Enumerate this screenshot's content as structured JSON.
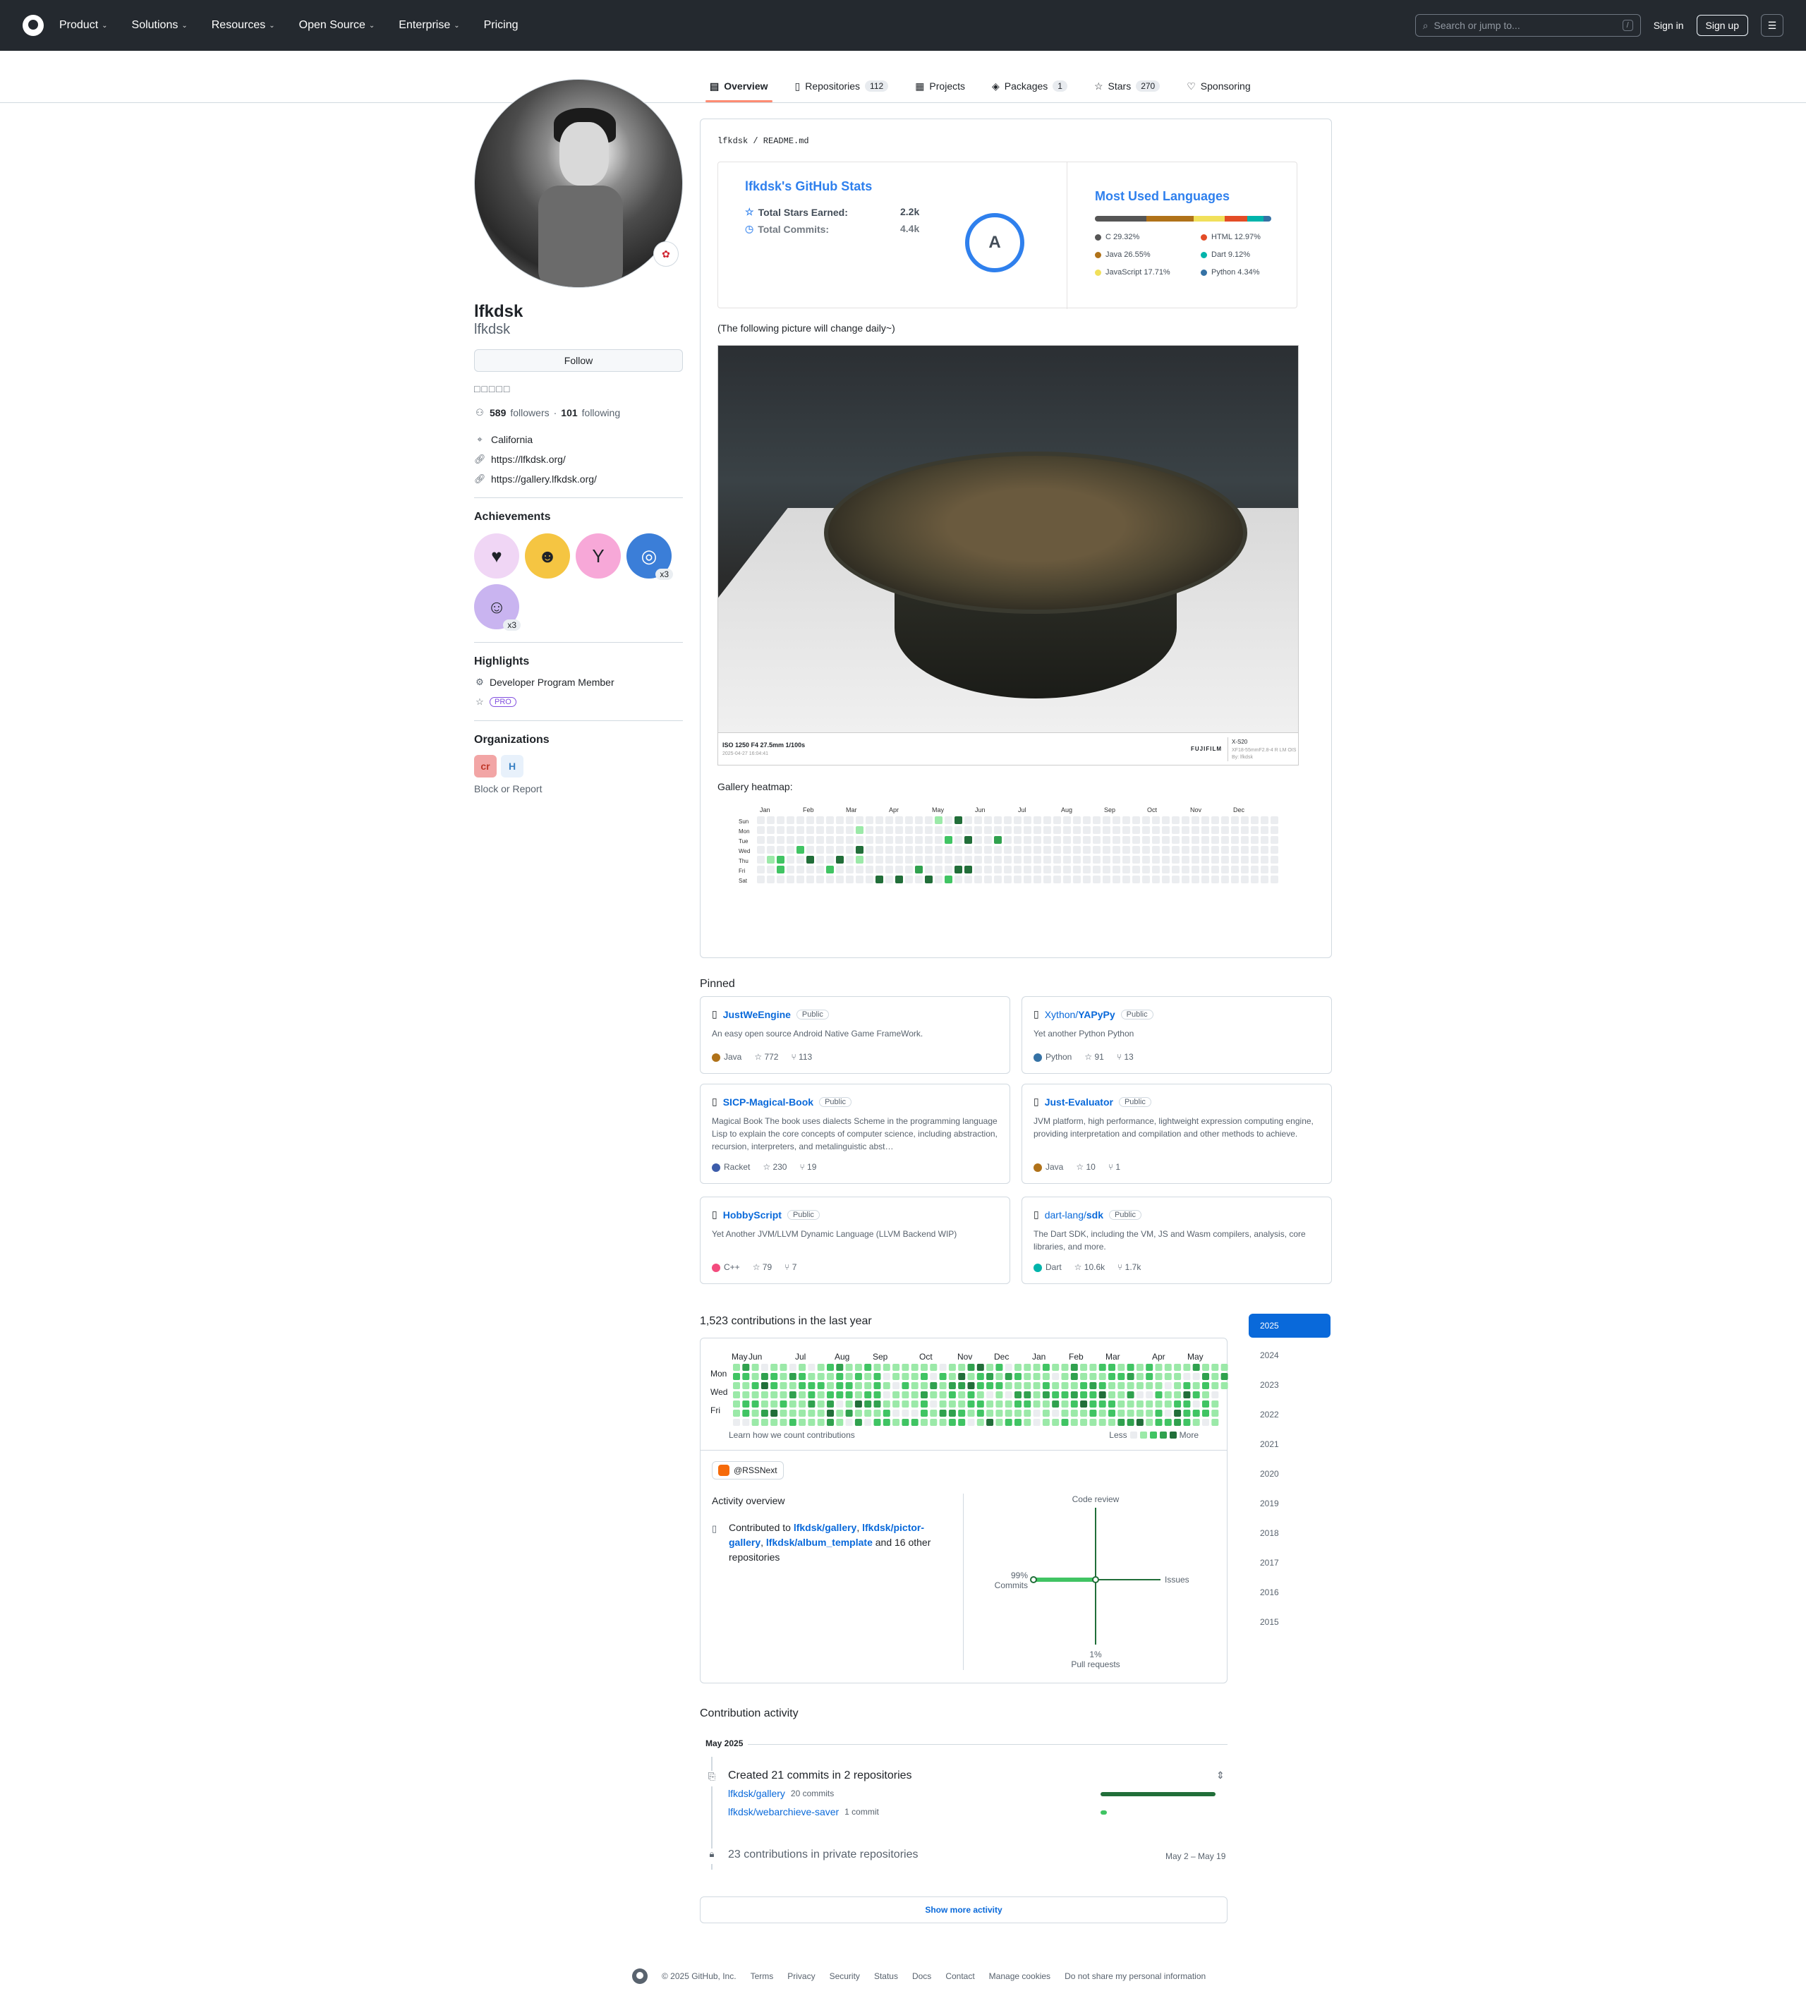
{
  "header": {
    "nav": [
      "Product",
      "Solutions",
      "Resources",
      "Open Source",
      "Enterprise",
      "Pricing"
    ],
    "search_placeholder": "Search or jump to...",
    "slash": "/",
    "signin": "Sign in",
    "signup": "Sign up"
  },
  "tabs": [
    {
      "label": "Overview"
    },
    {
      "label": "Repositories",
      "count": "112"
    },
    {
      "label": "Projects"
    },
    {
      "label": "Packages",
      "count": "1"
    },
    {
      "label": "Stars",
      "count": "270"
    },
    {
      "label": "Sponsoring"
    }
  ],
  "profile": {
    "name": "lfkdsk",
    "login": "lfkdsk",
    "follow": "Follow",
    "bio": "□□□□□",
    "followers": "589",
    "followers_label": "followers",
    "following": "101",
    "following_label": "following",
    "location": "California",
    "links": [
      "https://lfkdsk.org/",
      "https://gallery.lfkdsk.org/"
    ]
  },
  "achievements": {
    "title": "Achievements",
    "badges": [
      {
        "x": ""
      },
      {
        "x": ""
      },
      {
        "x": ""
      },
      {
        "x": "x3"
      },
      {
        "x": "x3"
      }
    ]
  },
  "highlights": {
    "title": "Highlights",
    "member": "Developer Program Member",
    "pro": "PRO"
  },
  "organizations": {
    "title": "Organizations",
    "block": "Block or Report"
  },
  "readme": {
    "path": "lfkdsk / README.md",
    "stats_title": "lfkdsk's GitHub Stats",
    "stars_label": "Total Stars Earned:",
    "stars_val": "2.2k",
    "commits_label": "Total Commits:",
    "commits_val": "4.4k",
    "grade": "A",
    "lang_title": "Most Used Languages",
    "langs": [
      {
        "name": "C 29.32%",
        "color": "#555555",
        "pct": 29.32
      },
      {
        "name": "Java 26.55%",
        "color": "#b07219",
        "pct": 26.55
      },
      {
        "name": "JavaScript 17.71%",
        "color": "#f1e05a",
        "pct": 17.71
      },
      {
        "name": "HTML 12.97%",
        "color": "#e34c26",
        "pct": 12.97
      },
      {
        "name": "Dart 9.12%",
        "color": "#00b4ab",
        "pct": 9.12
      },
      {
        "name": "Python 4.34%",
        "color": "#3572A5",
        "pct": 4.34
      }
    ],
    "note": "(The following picture will change daily~)",
    "photo_caption": "ISO 1250 F4 27.5mm 1/100s",
    "photo_date": "2025-04-27 16:04:41",
    "photo_brand": "FUJIFILM",
    "photo_model": "X-S20",
    "photo_lens": "XF18-55mmF2.8-4 R LM OIS",
    "photo_by": "By: lfkdsk",
    "gallery_heatmap": "Gallery heatmap:",
    "hm_months": [
      "Jan",
      "Feb",
      "Mar",
      "Apr",
      "May",
      "Jun",
      "Jul",
      "Aug",
      "Sep",
      "Oct",
      "Nov",
      "Dec"
    ],
    "hm_days": [
      "Sun",
      "Mon",
      "Tue",
      "Wed",
      "Thu",
      "Fri",
      "Sat"
    ]
  },
  "pinned": {
    "title": "Pinned",
    "items": [
      {
        "owner": "",
        "name": "JustWeEngine",
        "vis": "Public",
        "desc": "An easy open source Android Native Game FrameWork.",
        "lang": "Java",
        "color": "#b07219",
        "stars": "772",
        "forks": "113"
      },
      {
        "owner": "Xython/",
        "name": "YAPyPy",
        "vis": "Public",
        "desc": "Yet another Python Python",
        "lang": "Python",
        "color": "#3572A5",
        "stars": "91",
        "forks": "13"
      },
      {
        "owner": "",
        "name": "SICP-Magical-Book",
        "vis": "Public",
        "desc": "Magical Book The book uses dialects Scheme in the programming language Lisp to explain the core concepts of computer science, including abstraction, recursion, interpreters, and metalinguistic abst…",
        "lang": "Racket",
        "color": "#3c5caa",
        "stars": "230",
        "forks": "19"
      },
      {
        "owner": "",
        "name": "Just-Evaluator",
        "vis": "Public",
        "desc": "JVM platform, high performance, lightweight expression computing engine, providing interpretation and compilation and other methods to achieve.",
        "lang": "Java",
        "color": "#b07219",
        "stars": "10",
        "forks": "1"
      },
      {
        "owner": "",
        "name": "HobbyScript",
        "vis": "Public",
        "desc": "Yet Another JVM/LLVM Dynamic Language (LLVM Backend WIP)",
        "lang": "C++",
        "color": "#f34b7d",
        "stars": "79",
        "forks": "7"
      },
      {
        "owner": "dart-lang/",
        "name": "sdk",
        "vis": "Public",
        "desc": "The Dart SDK, including the VM, JS and Wasm compilers, analysis, core libraries, and more.",
        "lang": "Dart",
        "color": "#00b4ab",
        "stars": "10.6k",
        "forks": "1.7k"
      }
    ]
  },
  "contrib": {
    "title": "1,523 contributions in the last year",
    "months": [
      "May",
      "Jun",
      "Jul",
      "Aug",
      "Sep",
      "Oct",
      "Nov",
      "Dec",
      "Jan",
      "Feb",
      "Mar",
      "Apr",
      "May"
    ],
    "days": [
      "Mon",
      "Wed",
      "Fri"
    ],
    "learn": "Learn how we count contributions",
    "less": "Less",
    "more": "More",
    "rss": "@RSSNext",
    "activity_title": "Activity overview",
    "contributed": "Contributed to",
    "repo1": "lfkdsk/gallery",
    "repo2": "lfkdsk/pictor-gallery",
    "repo3": "lfkdsk/album_template",
    "others": "and 16 other repositories",
    "code_review": "Code review",
    "issues": "Issues",
    "commits_pct": "99%",
    "commits": "Commits",
    "pr_pct": "1%",
    "pr": "Pull requests"
  },
  "years": [
    "2025",
    "2024",
    "2023",
    "2022",
    "2021",
    "2020",
    "2019",
    "2018",
    "2017",
    "2016",
    "2015"
  ],
  "activity": {
    "title": "Contribution activity",
    "month": "May 2025",
    "created": "Created 21 commits in 2 repositories",
    "r1": "lfkdsk/gallery",
    "r1c": "20 commits",
    "r1pct": 95,
    "r2": "lfkdsk/webarchieve-saver",
    "r2c": "1 commit",
    "r2pct": 5,
    "private": "23 contributions in private repositories",
    "dates": "May 2 – May 19",
    "show_more": "Show more activity"
  },
  "footer": [
    "© 2025 GitHub, Inc.",
    "Terms",
    "Privacy",
    "Security",
    "Status",
    "Docs",
    "Contact",
    "Manage cookies",
    "Do not share my personal information"
  ],
  "colors": {
    "accent": "#0969da",
    "green0": "#ebedf0",
    "green1": "#9be9a8",
    "green2": "#40c463",
    "green3": "#30a14e",
    "green4": "#216e39"
  }
}
